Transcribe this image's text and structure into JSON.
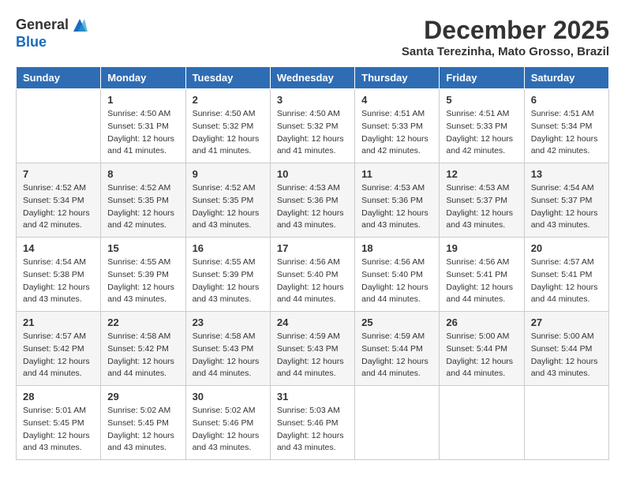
{
  "logo": {
    "general": "General",
    "blue": "Blue"
  },
  "title": "December 2025",
  "subtitle": "Santa Terezinha, Mato Grosso, Brazil",
  "days_header": [
    "Sunday",
    "Monday",
    "Tuesday",
    "Wednesday",
    "Thursday",
    "Friday",
    "Saturday"
  ],
  "weeks": [
    [
      {
        "day": "",
        "info": ""
      },
      {
        "day": "1",
        "info": "Sunrise: 4:50 AM\nSunset: 5:31 PM\nDaylight: 12 hours\nand 41 minutes."
      },
      {
        "day": "2",
        "info": "Sunrise: 4:50 AM\nSunset: 5:32 PM\nDaylight: 12 hours\nand 41 minutes."
      },
      {
        "day": "3",
        "info": "Sunrise: 4:50 AM\nSunset: 5:32 PM\nDaylight: 12 hours\nand 41 minutes."
      },
      {
        "day": "4",
        "info": "Sunrise: 4:51 AM\nSunset: 5:33 PM\nDaylight: 12 hours\nand 42 minutes."
      },
      {
        "day": "5",
        "info": "Sunrise: 4:51 AM\nSunset: 5:33 PM\nDaylight: 12 hours\nand 42 minutes."
      },
      {
        "day": "6",
        "info": "Sunrise: 4:51 AM\nSunset: 5:34 PM\nDaylight: 12 hours\nand 42 minutes."
      }
    ],
    [
      {
        "day": "7",
        "info": "Sunrise: 4:52 AM\nSunset: 5:34 PM\nDaylight: 12 hours\nand 42 minutes."
      },
      {
        "day": "8",
        "info": "Sunrise: 4:52 AM\nSunset: 5:35 PM\nDaylight: 12 hours\nand 42 minutes."
      },
      {
        "day": "9",
        "info": "Sunrise: 4:52 AM\nSunset: 5:35 PM\nDaylight: 12 hours\nand 43 minutes."
      },
      {
        "day": "10",
        "info": "Sunrise: 4:53 AM\nSunset: 5:36 PM\nDaylight: 12 hours\nand 43 minutes."
      },
      {
        "day": "11",
        "info": "Sunrise: 4:53 AM\nSunset: 5:36 PM\nDaylight: 12 hours\nand 43 minutes."
      },
      {
        "day": "12",
        "info": "Sunrise: 4:53 AM\nSunset: 5:37 PM\nDaylight: 12 hours\nand 43 minutes."
      },
      {
        "day": "13",
        "info": "Sunrise: 4:54 AM\nSunset: 5:37 PM\nDaylight: 12 hours\nand 43 minutes."
      }
    ],
    [
      {
        "day": "14",
        "info": "Sunrise: 4:54 AM\nSunset: 5:38 PM\nDaylight: 12 hours\nand 43 minutes."
      },
      {
        "day": "15",
        "info": "Sunrise: 4:55 AM\nSunset: 5:39 PM\nDaylight: 12 hours\nand 43 minutes."
      },
      {
        "day": "16",
        "info": "Sunrise: 4:55 AM\nSunset: 5:39 PM\nDaylight: 12 hours\nand 43 minutes."
      },
      {
        "day": "17",
        "info": "Sunrise: 4:56 AM\nSunset: 5:40 PM\nDaylight: 12 hours\nand 44 minutes."
      },
      {
        "day": "18",
        "info": "Sunrise: 4:56 AM\nSunset: 5:40 PM\nDaylight: 12 hours\nand 44 minutes."
      },
      {
        "day": "19",
        "info": "Sunrise: 4:56 AM\nSunset: 5:41 PM\nDaylight: 12 hours\nand 44 minutes."
      },
      {
        "day": "20",
        "info": "Sunrise: 4:57 AM\nSunset: 5:41 PM\nDaylight: 12 hours\nand 44 minutes."
      }
    ],
    [
      {
        "day": "21",
        "info": "Sunrise: 4:57 AM\nSunset: 5:42 PM\nDaylight: 12 hours\nand 44 minutes."
      },
      {
        "day": "22",
        "info": "Sunrise: 4:58 AM\nSunset: 5:42 PM\nDaylight: 12 hours\nand 44 minutes."
      },
      {
        "day": "23",
        "info": "Sunrise: 4:58 AM\nSunset: 5:43 PM\nDaylight: 12 hours\nand 44 minutes."
      },
      {
        "day": "24",
        "info": "Sunrise: 4:59 AM\nSunset: 5:43 PM\nDaylight: 12 hours\nand 44 minutes."
      },
      {
        "day": "25",
        "info": "Sunrise: 4:59 AM\nSunset: 5:44 PM\nDaylight: 12 hours\nand 44 minutes."
      },
      {
        "day": "26",
        "info": "Sunrise: 5:00 AM\nSunset: 5:44 PM\nDaylight: 12 hours\nand 44 minutes."
      },
      {
        "day": "27",
        "info": "Sunrise: 5:00 AM\nSunset: 5:44 PM\nDaylight: 12 hours\nand 43 minutes."
      }
    ],
    [
      {
        "day": "28",
        "info": "Sunrise: 5:01 AM\nSunset: 5:45 PM\nDaylight: 12 hours\nand 43 minutes."
      },
      {
        "day": "29",
        "info": "Sunrise: 5:02 AM\nSunset: 5:45 PM\nDaylight: 12 hours\nand 43 minutes."
      },
      {
        "day": "30",
        "info": "Sunrise: 5:02 AM\nSunset: 5:46 PM\nDaylight: 12 hours\nand 43 minutes."
      },
      {
        "day": "31",
        "info": "Sunrise: 5:03 AM\nSunset: 5:46 PM\nDaylight: 12 hours\nand 43 minutes."
      },
      {
        "day": "",
        "info": ""
      },
      {
        "day": "",
        "info": ""
      },
      {
        "day": "",
        "info": ""
      }
    ]
  ]
}
